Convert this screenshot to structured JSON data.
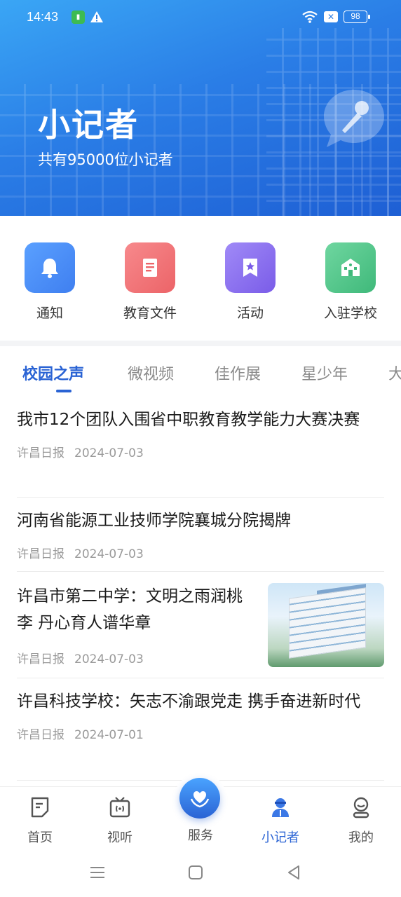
{
  "status": {
    "time": "14:43",
    "battery": "98"
  },
  "header": {
    "title": "小记者",
    "subtitle": "共有95000位小记者"
  },
  "quick_menu": [
    {
      "label": "通知",
      "icon": "bell-icon",
      "color": "#4d8ef5"
    },
    {
      "label": "教育文件",
      "icon": "document-icon",
      "color": "#f0757a"
    },
    {
      "label": "活动",
      "icon": "bookmark-star-icon",
      "color": "#8a6cf0"
    },
    {
      "label": "入驻学校",
      "icon": "school-icon",
      "color": "#4fc48a"
    }
  ],
  "tabs": [
    {
      "label": "校园之声",
      "active": true
    },
    {
      "label": "微视频"
    },
    {
      "label": "佳作展"
    },
    {
      "label": "星少年"
    },
    {
      "label": "大"
    }
  ],
  "news": [
    {
      "title": "我市12个团队入围省中职教育教学能力大赛决赛",
      "source": "许昌日报",
      "date": "2024-07-03"
    },
    {
      "title": "河南省能源工业技师学院襄城分院揭牌",
      "source": "许昌日报",
      "date": "2024-07-03"
    },
    {
      "title": "许昌市第二中学：文明之雨润桃李 丹心育人谱华章",
      "source": "许昌日报",
      "date": "2024-07-03",
      "thumbnail": true
    },
    {
      "title": "许昌科技学校：矢志不渝跟党走 携手奋进新时代",
      "source": "许昌日报",
      "date": "2024-07-01"
    }
  ],
  "bottom_nav": {
    "home": "首页",
    "media": "视听",
    "service": "服务",
    "reporter": "小记者",
    "mine": "我的"
  },
  "colors": {
    "accent": "#2a63d4",
    "header": "#2a7de6"
  }
}
